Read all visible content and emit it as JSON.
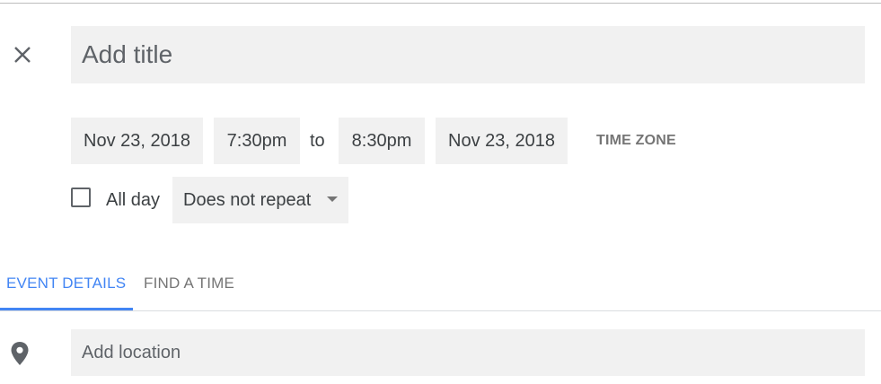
{
  "title_field": {
    "placeholder": "Add title",
    "value": ""
  },
  "datetime": {
    "start_date": "Nov 23, 2018",
    "start_time": "7:30pm",
    "separator": "to",
    "end_time": "8:30pm",
    "end_date": "Nov 23, 2018",
    "time_zone_label": "TIME ZONE"
  },
  "all_day": {
    "label": "All day",
    "checked": false
  },
  "repeat": {
    "selected": "Does not repeat"
  },
  "tabs": [
    {
      "label": "EVENT DETAILS",
      "active": true
    },
    {
      "label": "FIND A TIME",
      "active": false
    }
  ],
  "location_field": {
    "placeholder": "Add location",
    "value": ""
  },
  "icons": {
    "close": "close-icon",
    "location": "location-pin-icon",
    "dropdown": "caret-down-icon"
  },
  "colors": {
    "accent": "#4285f4",
    "field_bg": "#f1f1f1",
    "muted_text": "#757575"
  }
}
